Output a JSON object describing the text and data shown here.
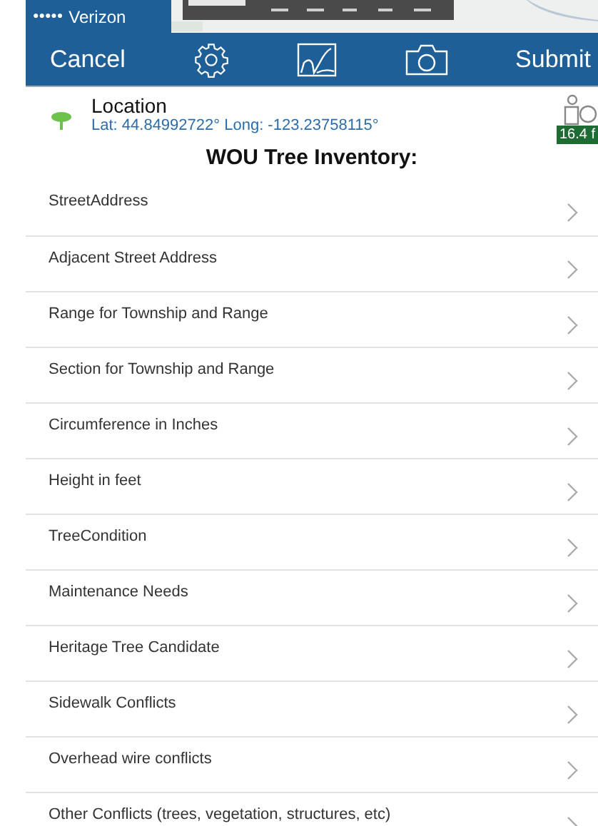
{
  "status_bar": {
    "signal_dots": "●●●●●",
    "carrier": "Verizon"
  },
  "nav_bar": {
    "cancel": "Cancel",
    "submit": "Submit"
  },
  "location": {
    "title": "Location",
    "coords": "Lat: 44.84992722° Long: -123.23758115°",
    "distance": "16.4 f"
  },
  "form_title": "WOU Tree Inventory:",
  "fields": [
    {
      "label": "StreetAddress"
    },
    {
      "label": "Adjacent Street Address"
    },
    {
      "label": "Range for Township and Range"
    },
    {
      "label": "Section for Township and Range"
    },
    {
      "label": "Circumference in Inches"
    },
    {
      "label": "Height in feet"
    },
    {
      "label": "TreeCondition"
    },
    {
      "label": "Maintenance Needs"
    },
    {
      "label": "Heritage Tree Candidate"
    },
    {
      "label": "Sidewalk Conflicts"
    },
    {
      "label": "Overhead wire conflicts"
    },
    {
      "label": "Other Conflicts (trees, vegetation, structures, etc)"
    }
  ]
}
